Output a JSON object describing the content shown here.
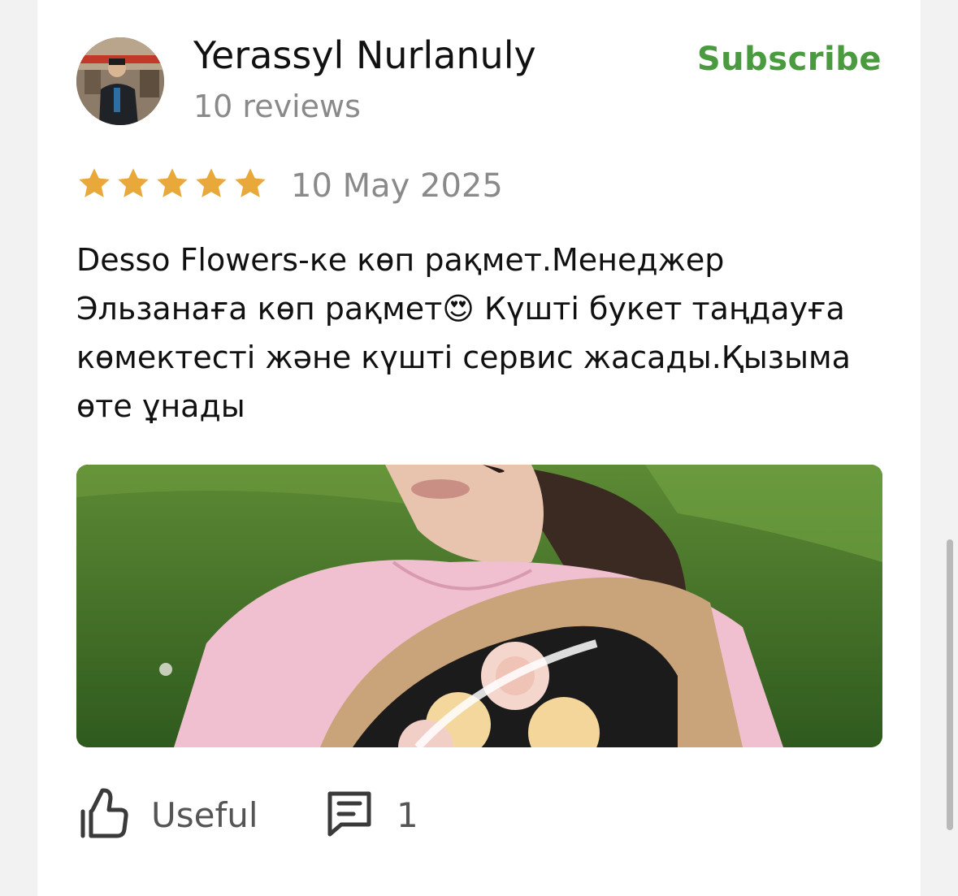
{
  "review": {
    "author": {
      "name": "Yerassyl Nurlanuly",
      "reviews_count": "10 reviews",
      "avatar_icon": "user-photo"
    },
    "subscribe_label": "Subscribe",
    "rating": 5,
    "rating_max": 5,
    "date": "10 May 2025",
    "text": "Desso  Flowers-ке көп рақмет.Менеджер Эльзанаға көп рақмет😍 Күшті букет таңдауға көмектесті және күшті сервис жасады.Қызыма өте ұнады",
    "photo_icon": "review-photo",
    "actions": {
      "useful_label": "Useful",
      "useful_icon": "thumbs-up-icon",
      "comments_count": "1",
      "comments_icon": "comment-icon"
    }
  },
  "colors": {
    "accent_green": "#4a9a3f",
    "star_gold": "#e8a93a",
    "text_primary": "#111111",
    "text_secondary": "#8a8a8a"
  }
}
